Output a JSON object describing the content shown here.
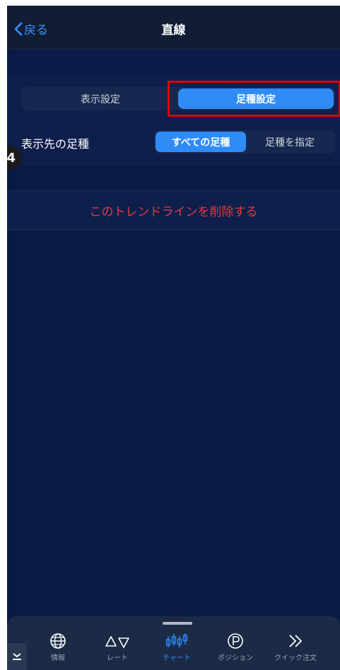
{
  "nav": {
    "back_label": "戻る",
    "title": "直線"
  },
  "tabs": [
    {
      "label": "表示設定",
      "active": false
    },
    {
      "label": "足種設定",
      "active": true
    }
  ],
  "timeframe_row": {
    "label": "表示先の足種",
    "options": [
      {
        "label": "すべての足種",
        "active": true
      },
      {
        "label": "足種を指定",
        "active": false
      }
    ]
  },
  "delete_label": "このトレンドラインを削除する",
  "step_badge": "4",
  "tabbar": {
    "items": [
      {
        "label": "情報",
        "icon": "globe-icon",
        "active": false
      },
      {
        "label": "レート",
        "icon": "up-down-triangle-icon",
        "active": false
      },
      {
        "label": "チャート",
        "icon": "candlestick-icon",
        "active": true
      },
      {
        "label": "ポジション",
        "icon": "p-circle-icon",
        "active": false
      },
      {
        "label": "クイック注文",
        "icon": "double-chevron-icon",
        "active": false
      }
    ]
  },
  "colors": {
    "accent": "#2f8cf7",
    "background": "#0a1a44",
    "danger": "#e53a3a",
    "highlight": "#e00000"
  }
}
